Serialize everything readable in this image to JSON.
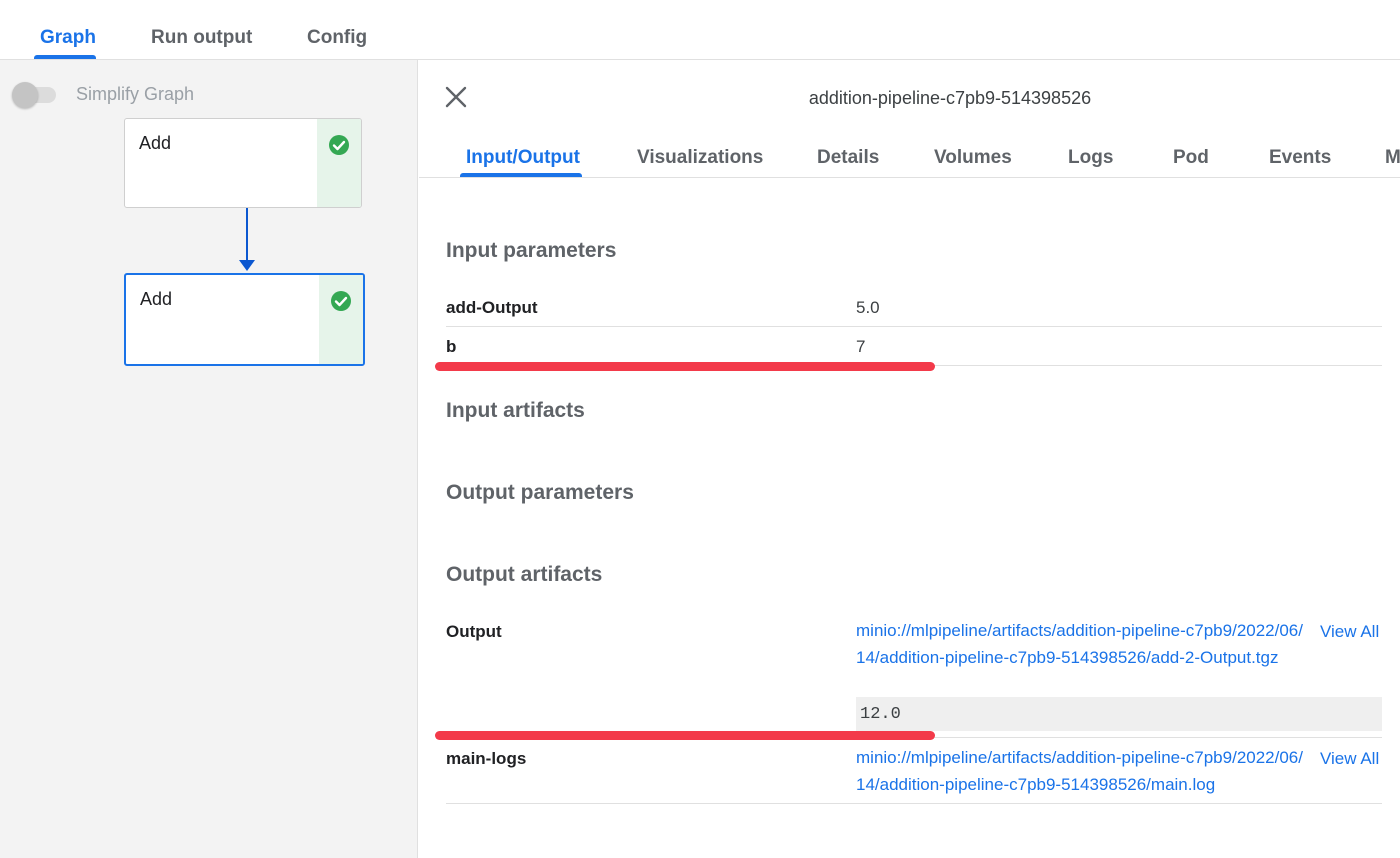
{
  "top_tabs": [
    {
      "label": "Graph",
      "active": true
    },
    {
      "label": "Run output",
      "active": false
    },
    {
      "label": "Config",
      "active": false
    }
  ],
  "graph": {
    "simplify_label": "Simplify Graph",
    "simplify_enabled": false,
    "nodes": [
      {
        "label": "Add",
        "status": "succeeded",
        "selected": false
      },
      {
        "label": "Add",
        "status": "succeeded",
        "selected": true
      }
    ]
  },
  "detail": {
    "title": "addition-pipeline-c7pb9-514398526",
    "tabs": [
      {
        "label": "Input/Output",
        "active": true
      },
      {
        "label": "Visualizations",
        "active": false
      },
      {
        "label": "Details",
        "active": false
      },
      {
        "label": "Volumes",
        "active": false
      },
      {
        "label": "Logs",
        "active": false
      },
      {
        "label": "Pod",
        "active": false
      },
      {
        "label": "Events",
        "active": false
      },
      {
        "label": "M",
        "active": false
      }
    ],
    "input_parameters": {
      "title": "Input parameters",
      "rows": [
        {
          "key": "add-Output",
          "value": "5.0"
        },
        {
          "key": "b",
          "value": "7"
        }
      ]
    },
    "input_artifacts": {
      "title": "Input artifacts"
    },
    "output_parameters": {
      "title": "Output parameters"
    },
    "output_artifacts": {
      "title": "Output artifacts",
      "rows": [
        {
          "key": "Output",
          "uri": "minio://mlpipeline/artifacts/addition-pipeline-c7pb9/2022/06/14/addition-pipeline-c7pb9-514398526/add-2-Output.tgz",
          "view_all": "View All",
          "preview": "12.0"
        },
        {
          "key": "main-logs",
          "uri": "minio://mlpipeline/artifacts/addition-pipeline-c7pb9/2022/06/14/addition-pipeline-c7pb9-514398526/main.log",
          "view_all": "View All"
        }
      ]
    }
  },
  "colors": {
    "accent": "#1a73e8",
    "success": "#34a853",
    "annotation": "#f33a4a"
  }
}
